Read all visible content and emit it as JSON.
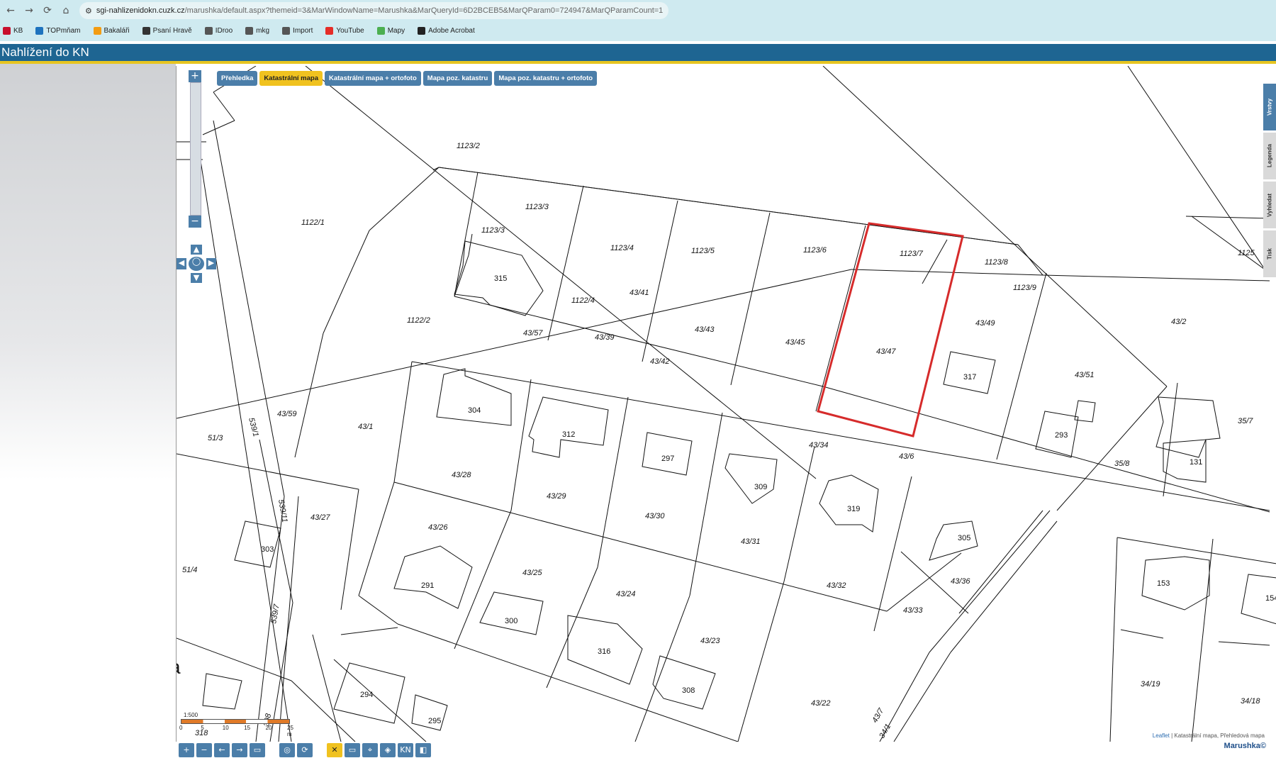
{
  "browser": {
    "nav": {
      "back": "←",
      "forward": "→",
      "reload": "⟳",
      "home": "⌂"
    },
    "url_domain": "sgi-nahlizenidokn.cuzk.cz",
    "url_path": "/marushka/default.aspx?themeid=3&MarWindowName=Marushka&MarQueryId=6D2BCEB5&MarQParam0=724947&MarQParamCount=1",
    "bookmarks": [
      {
        "label": "KB",
        "color": "#c8102e"
      },
      {
        "label": "TOPmňam",
        "color": "#1e73be"
      },
      {
        "label": "Bakaláři",
        "color": "#f39c12"
      },
      {
        "label": "Psaní Hravě",
        "color": "#333333"
      },
      {
        "label": "IDroo",
        "color": "#555555"
      },
      {
        "label": "mkg",
        "color": "#555555"
      },
      {
        "label": "Import",
        "color": "#555555"
      },
      {
        "label": "YouTube",
        "color": "#e52d27"
      },
      {
        "label": "Mapy",
        "color": "#4caf50"
      },
      {
        "label": "Adobe Acrobat",
        "color": "#222222"
      }
    ]
  },
  "app": {
    "title": "Nahlížení do KN"
  },
  "map_tabs": [
    "Přehledka",
    "Katastrální mapa",
    "Katastrální mapa + ortofoto",
    "Mapa poz. katastru",
    "Mapa poz. katastru + ortofoto"
  ],
  "active_tab": "Katastrální mapa",
  "side_tabs": [
    "Vrstvy",
    "Legenda",
    "Vyhledat",
    "Tisk"
  ],
  "zoom": {
    "plus": "+",
    "minus": "−"
  },
  "scale": {
    "ratio": "1:500",
    "ticks": [
      "0",
      "5",
      "10",
      "15",
      "20",
      "25 m"
    ]
  },
  "attribution": {
    "leaflet": "Leaflet",
    "text": "| Katastrální mapa, Přehledová mapa"
  },
  "brand": "Marushka©",
  "highlighted_parcel": "43/47",
  "colors": {
    "highlight": "#d62b2b",
    "title_bar": "#1e6592",
    "accent_yellow": "#f0c21f",
    "button_blue": "#4b7ea9"
  },
  "labels": {
    "p1123_2": "1123/2",
    "p1123_3a": "1123/3",
    "p1123_3b": "1123/3",
    "p1122_1": "1122/1",
    "p1123_4": "1123/4",
    "p1123_5": "1123/5",
    "p1123_6": "1123/6",
    "p1123_7": "1123/7",
    "p1123_8": "1123/8",
    "p1123_9": "1123/9",
    "p1125": "1125",
    "p1122_4": "1122/4",
    "p1122_2": "1122/2",
    "p43_41": "43/41",
    "p43_57": "43/57",
    "p43_39": "43/39",
    "p43_43": "43/43",
    "p43_42": "43/42",
    "p43_45": "43/45",
    "p43_47": "43/47",
    "p43_49": "43/49",
    "p43_51": "43/51",
    "p43_2": "43/2",
    "b315": "315",
    "b317": "317",
    "b293": "293",
    "p35_7": "35/7",
    "p35_8": "35/8",
    "b131": "131",
    "p43_59": "43/59",
    "p51_3": "51/3",
    "p43_1": "43/1",
    "p539_1": "539/1",
    "p539_11": "539/11",
    "p539_7": "539/7",
    "b304": "304",
    "b312": "312",
    "b297": "297",
    "b309": "309",
    "p43_34": "43/34",
    "p43_6": "43/6",
    "b319": "319",
    "p43_28": "43/28",
    "p43_29": "43/29",
    "p43_27": "43/27",
    "b303": "303",
    "p43_26": "43/26",
    "p43_30": "43/30",
    "p43_31": "43/31",
    "b305": "305",
    "p51_4": "51/4",
    "b291": "291",
    "p43_25": "43/25",
    "p43_24": "43/24",
    "p43_32": "43/32",
    "p43_36": "43/36",
    "b153": "153",
    "b154": "154",
    "b300": "300",
    "b316": "316",
    "p43_33": "43/33",
    "p43_23": "43/23",
    "b294": "294",
    "b295": "295",
    "b308": "308",
    "p43_22": "43/22",
    "p34_19": "34/19",
    "p34_18": "34/18",
    "p318": "318",
    "p398": "398",
    "p43_7": "43/7",
    "p34_1": "34/1",
    "ra": "a"
  },
  "tools": [
    "+",
    "−",
    "←",
    "→",
    "▭",
    "◎",
    "⟳",
    "✕",
    "▭",
    "⌖",
    "◈",
    "KN",
    "◧"
  ]
}
